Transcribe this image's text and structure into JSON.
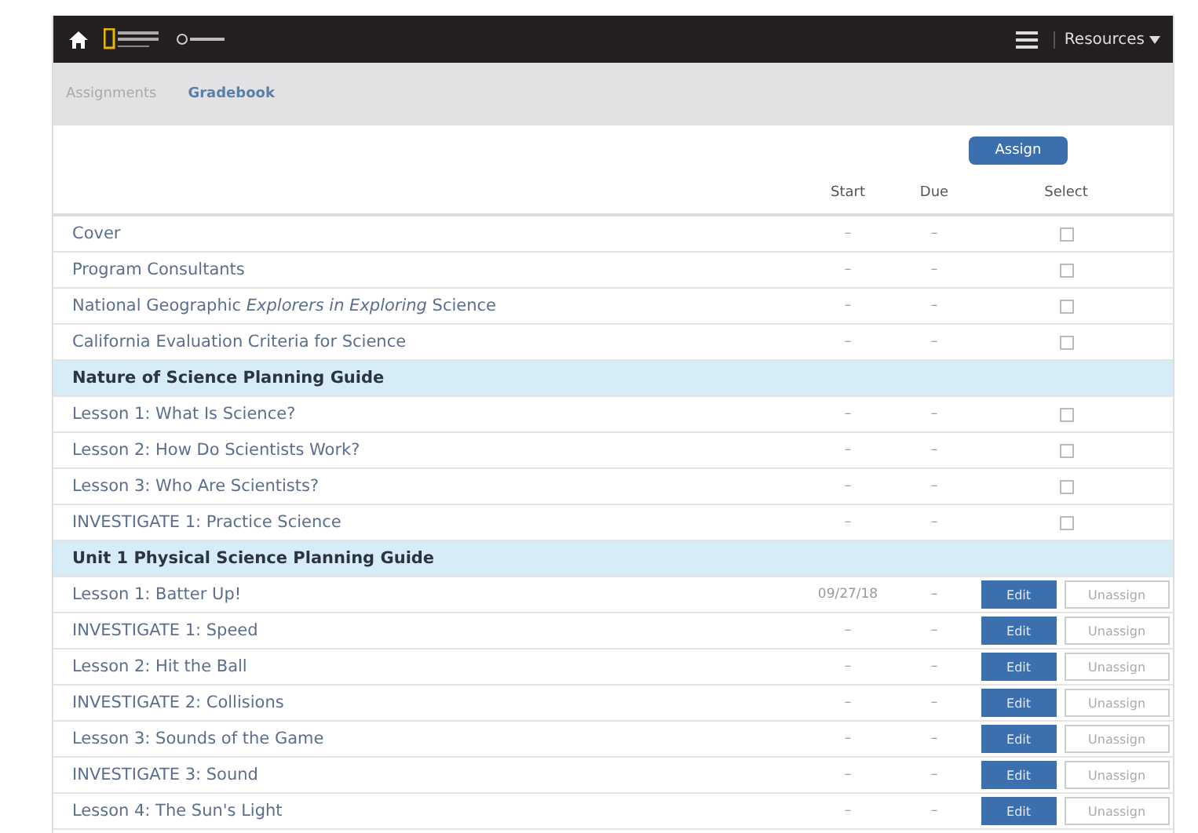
{
  "navbar": {
    "resources": "Resources"
  },
  "breadcrumbs": [
    {
      "label": "Assignments",
      "selected": false
    },
    {
      "label": "Gradebook",
      "selected": true
    }
  ],
  "assign_button": "Assign",
  "columns": {
    "start": "Start",
    "due": "Due",
    "select": "Select"
  },
  "rows": [
    {
      "kind": "item",
      "title": "Cover",
      "start": "–",
      "due": "–",
      "checked": false
    },
    {
      "kind": "item",
      "title": "Program Consultants",
      "start": "–",
      "due": "–",
      "checked": false
    },
    {
      "kind": "item",
      "title": "National Geographic *Explorers in Exploring* Science",
      "start": "–",
      "due": "–",
      "checked": false
    },
    {
      "kind": "item",
      "title": "California Evaluation Criteria for Science",
      "start": "–",
      "due": "–",
      "checked": false
    },
    {
      "kind": "section",
      "title": "Nature of Science Planning Guide"
    },
    {
      "kind": "item",
      "title": "Lesson 1: What Is Science?",
      "start": "–",
      "due": "–",
      "checked": false
    },
    {
      "kind": "item",
      "title": "Lesson 2: How Do Scientists Work?",
      "start": "–",
      "due": "–",
      "checked": false
    },
    {
      "kind": "item",
      "title": "Lesson 3: Who Are Scientists?",
      "start": "–",
      "due": "–",
      "checked": false
    },
    {
      "kind": "item",
      "title": "INVESTIGATE 1: Practice Science",
      "start": "–",
      "due": "–",
      "checked": false
    },
    {
      "kind": "section",
      "title": "Unit 1 Physical Science Planning Guide"
    },
    {
      "kind": "assigned",
      "title": "Lesson 1: Batter Up!",
      "start": "09/27/18",
      "due": "–",
      "edit": "Edit",
      "unassign": "Unassign"
    },
    {
      "kind": "assigned",
      "title": "INVESTIGATE 1: Speed",
      "start": "–",
      "due": "–",
      "edit": "Edit",
      "unassign": "Unassign"
    },
    {
      "kind": "assigned",
      "title": "Lesson 2: Hit the Ball",
      "start": "–",
      "due": "–",
      "edit": "Edit",
      "unassign": "Unassign"
    },
    {
      "kind": "assigned",
      "title": "INVESTIGATE 2: Collisions",
      "start": "–",
      "due": "–",
      "edit": "Edit",
      "unassign": "Unassign"
    },
    {
      "kind": "assigned",
      "title": "Lesson 3: Sounds of the Game",
      "start": "–",
      "due": "–",
      "edit": "Edit",
      "unassign": "Unassign"
    },
    {
      "kind": "assigned",
      "title": "INVESTIGATE 3: Sound",
      "start": "–",
      "due": "–",
      "edit": "Edit",
      "unassign": "Unassign"
    },
    {
      "kind": "assigned",
      "title": "Lesson 4: The Sun's Light",
      "start": "–",
      "due": "–",
      "edit": "Edit",
      "unassign": "Unassign"
    }
  ]
}
